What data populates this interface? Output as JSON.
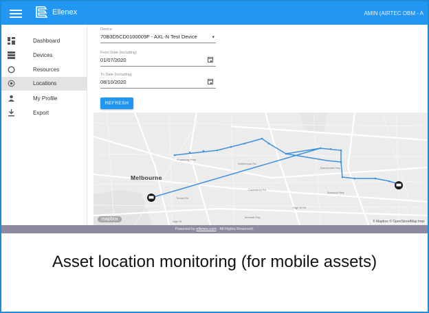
{
  "header": {
    "brand": "Ellenex",
    "user": "AMIN (AIRTEC OBM - A"
  },
  "sidebar": {
    "items": [
      {
        "label": "Dashboard",
        "icon": "dashboard-icon"
      },
      {
        "label": "Devices",
        "icon": "devices-icon"
      },
      {
        "label": "Resources",
        "icon": "resources-icon"
      },
      {
        "label": "Locations",
        "icon": "location-icon",
        "active": true
      },
      {
        "label": "My Profile",
        "icon": "person-icon"
      },
      {
        "label": "Export",
        "icon": "download-icon"
      }
    ]
  },
  "form": {
    "device_label": "Device",
    "device_value": "70B3D5CD0100009F - AXL-N Test Device",
    "from_label": "From Date (including)",
    "from_value": "01/07/2020",
    "to_label": "To Date (including)",
    "to_value": "08/10/2020",
    "refresh_label": "REFRESH"
  },
  "map": {
    "city": "Melbourne",
    "logo": "mapbox",
    "attribution": "© Mapbox © OpenStreetMap Impr",
    "place_labels": [
      "Footscray Park",
      "Whitehorse Rd",
      "Canterbury Rd",
      "Maroondah Hwy",
      "Burwood Hwy",
      "Toorak Rd",
      "High St",
      "Monash Fwy",
      "High St Rd"
    ],
    "colors": {
      "route": "#3d8fe0",
      "marker": "#1a1a1a"
    }
  },
  "footer": {
    "prefix": "Powered by ",
    "link": "ellenex.com",
    "suffix": " - All Rights Reserved."
  },
  "caption": "Asset location monitoring (for mobile assets)"
}
